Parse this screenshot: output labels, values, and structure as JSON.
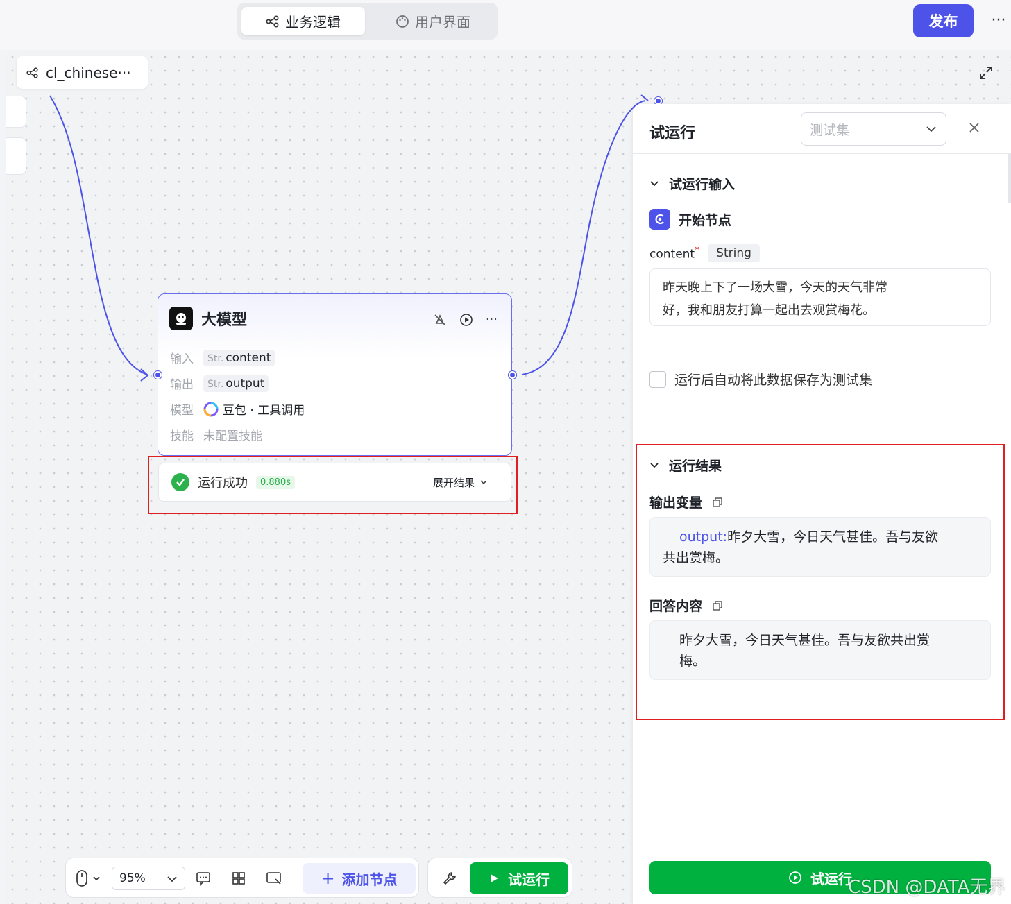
{
  "header": {
    "tabs": [
      {
        "label": "业务逻辑",
        "icon": "workflow-icon",
        "active": true
      },
      {
        "label": "用户界面",
        "icon": "palette-icon",
        "active": false
      }
    ],
    "publish_label": "发布",
    "more_label": "···"
  },
  "workflow": {
    "name": "cl_chinese···"
  },
  "node": {
    "title": "大模型",
    "rows": [
      {
        "label": "输入",
        "type": "Str.",
        "value": "content"
      },
      {
        "label": "输出",
        "type": "Str.",
        "value": "output"
      },
      {
        "label": "模型",
        "value": "豆包 · 工具调用"
      },
      {
        "label": "技能",
        "value": "未配置技能"
      }
    ],
    "status": {
      "text": "运行成功",
      "time": "0.880s",
      "expand_label": "展开结果"
    }
  },
  "toolbar": {
    "zoom": "95%",
    "add_node_label": "添加节点",
    "run_label": "试运行"
  },
  "panel": {
    "title": "试运行",
    "testset_placeholder": "测试集",
    "input_section": "试运行输入",
    "start_node": "开始节点",
    "field_name": "content",
    "field_required": "*",
    "field_type": "String",
    "field_value_line1": "昨天晚上下了一场大雪，今天的天气非常",
    "field_value_line2": "好，我和朋友打算一起出去观赏梅花。",
    "save_checkbox_label": "运行后自动将此数据保存为测试集",
    "result_section": "运行结果",
    "output_var_label": "输出变量",
    "output_key": "output",
    "output_sep": ":",
    "output_line1": "昨夕大雪，今日天气甚佳。吾与友欲",
    "output_line2": "共出赏梅。",
    "answer_label": "回答内容",
    "answer_line1": "昨夕大雪，今日天气甚佳。吾与友欲共出赏",
    "answer_line2": "梅。",
    "run_button_label": "试运行"
  },
  "watermark": "CSDN @DATA无界",
  "colors": {
    "accent": "#4d53e8",
    "success": "#00b140",
    "highlight": "#e02020"
  }
}
